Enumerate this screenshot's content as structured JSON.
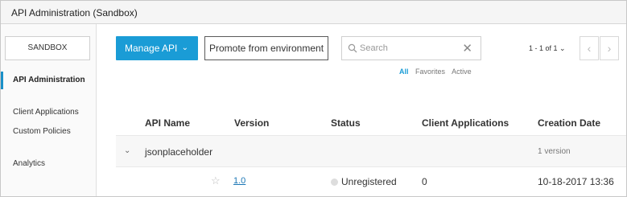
{
  "window": {
    "title": "API Administration (Sandbox)"
  },
  "sidebar": {
    "environment": "SANDBOX",
    "items": [
      {
        "label": "API Administration",
        "active": true
      },
      {
        "label": "Client Applications",
        "active": false
      },
      {
        "label": "Custom Policies",
        "active": false
      },
      {
        "label": "Analytics",
        "active": false
      }
    ]
  },
  "toolbar": {
    "manage_label": "Manage API",
    "manage_chevron": "⌄",
    "promote_label": "Promote from environment",
    "search_placeholder": "Search",
    "clear_icon": "✕"
  },
  "filters": {
    "all": "All",
    "favorites": "Favorites",
    "active": "Active"
  },
  "pager": {
    "text": "1 - 1 of 1",
    "chevron": "⌄",
    "prev": "‹",
    "next": "›"
  },
  "table": {
    "columns": [
      "API Name",
      "Version",
      "Status",
      "Client Applications",
      "Creation Date"
    ],
    "group": {
      "caret": "⌄",
      "name": "jsonplaceholder",
      "count": "1 version"
    },
    "row": {
      "star": "☆",
      "version": "1.0",
      "status": "Unregistered",
      "client_apps": "0",
      "created": "10-18-2017 13:36"
    }
  },
  "colors": {
    "accent": "#1a9cd6",
    "active_marker": "#1a90c8"
  }
}
